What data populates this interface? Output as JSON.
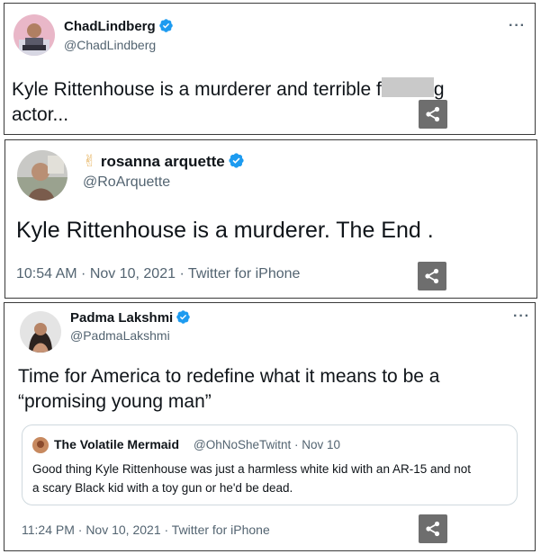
{
  "tweets": [
    {
      "name": "ChadLindberg",
      "handle": "@ChadLindberg",
      "text_part1": "Kyle Rittenhouse is a murderer and terrible f",
      "text_part2": "g",
      "text_line2": "actor...",
      "more": "···"
    },
    {
      "emoji": "✌",
      "name": "rosanna arquette",
      "handle": "@RoArquette",
      "text": "Kyle Rittenhouse is a murderer. The End .",
      "meta": "10:54 AM · Nov 10, 2021 · Twitter for iPhone"
    },
    {
      "name": "Padma Lakshmi",
      "handle": "@PadmaLakshmi",
      "more": "···",
      "text_line1": "Time for America to redefine what it means to be a",
      "text_line2": "“promising young man”",
      "quote": {
        "name": "The Volatile Mermaid",
        "handle_date": "@OhNoSheTwitnt · Nov 10",
        "text_line1": "Good thing Kyle Rittenhouse was just a harmless white kid with an AR-15 and not",
        "text_line2": "a scary Black kid with a toy gun or he'd be dead."
      },
      "meta": "11:24 PM · Nov 10, 2021 · Twitter for iPhone"
    }
  ],
  "colors": {
    "verified": "#1d9bf0",
    "text": "#0f1419",
    "secondary": "#536471",
    "share_bg": "#6e6e6e"
  },
  "icons": [
    "verified-badge-icon",
    "share-icon",
    "more-options-icon"
  ]
}
